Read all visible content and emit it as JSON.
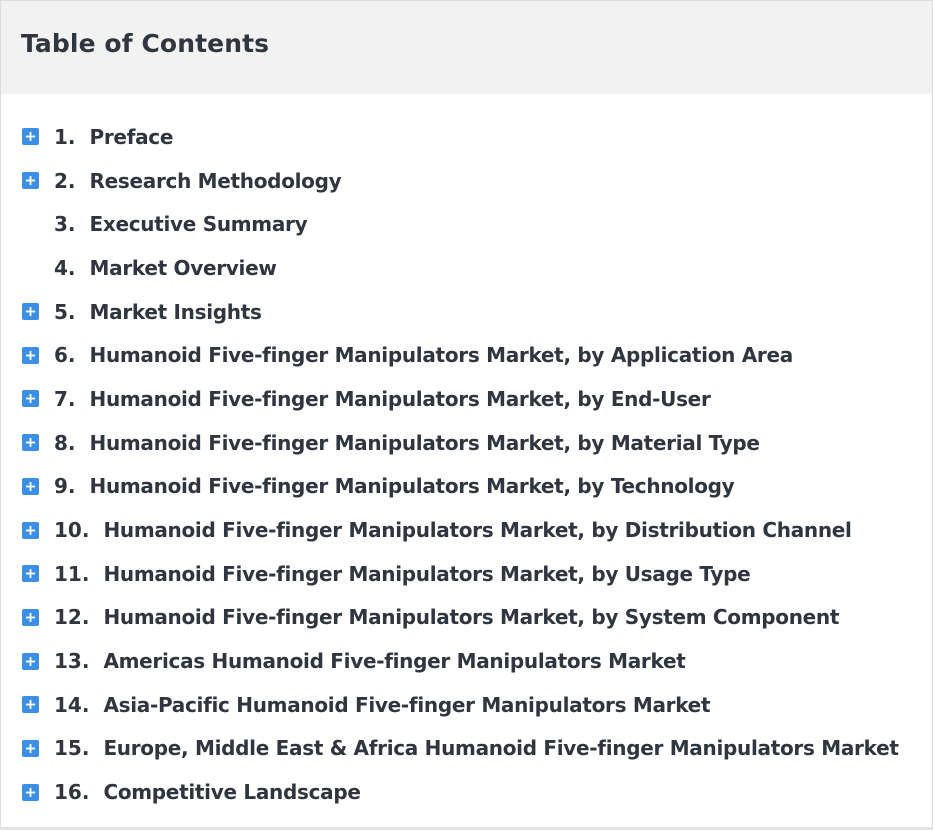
{
  "toc": {
    "title": "Table of Contents",
    "items": [
      {
        "num": "1.",
        "label": "Preface",
        "expandable": true
      },
      {
        "num": "2.",
        "label": "Research Methodology",
        "expandable": true
      },
      {
        "num": "3.",
        "label": "Executive Summary",
        "expandable": false
      },
      {
        "num": "4.",
        "label": "Market Overview",
        "expandable": false
      },
      {
        "num": "5.",
        "label": "Market Insights",
        "expandable": true
      },
      {
        "num": "6.",
        "label": "Humanoid Five-finger Manipulators Market, by Application Area",
        "expandable": true
      },
      {
        "num": "7.",
        "label": "Humanoid Five-finger Manipulators Market, by End-User",
        "expandable": true
      },
      {
        "num": "8.",
        "label": "Humanoid Five-finger Manipulators Market, by Material Type",
        "expandable": true
      },
      {
        "num": "9.",
        "label": "Humanoid Five-finger Manipulators Market, by Technology",
        "expandable": true
      },
      {
        "num": "10.",
        "label": "Humanoid Five-finger Manipulators Market, by Distribution Channel",
        "expandable": true
      },
      {
        "num": "11.",
        "label": "Humanoid Five-finger Manipulators Market, by Usage Type",
        "expandable": true
      },
      {
        "num": "12.",
        "label": "Humanoid Five-finger Manipulators Market, by System Component",
        "expandable": true
      },
      {
        "num": "13.",
        "label": "Americas Humanoid Five-finger Manipulators Market",
        "expandable": true
      },
      {
        "num": "14.",
        "label": "Asia-Pacific Humanoid Five-finger Manipulators Market",
        "expandable": true
      },
      {
        "num": "15.",
        "label": "Europe, Middle East & Africa Humanoid Five-finger Manipulators Market",
        "expandable": true
      },
      {
        "num": "16.",
        "label": "Competitive Landscape",
        "expandable": true
      }
    ]
  },
  "colors": {
    "accent": "#3d8fe6",
    "header_bg": "#f2f2f2",
    "text": "#2f3640"
  },
  "icons": {
    "expand": "plus-icon"
  }
}
